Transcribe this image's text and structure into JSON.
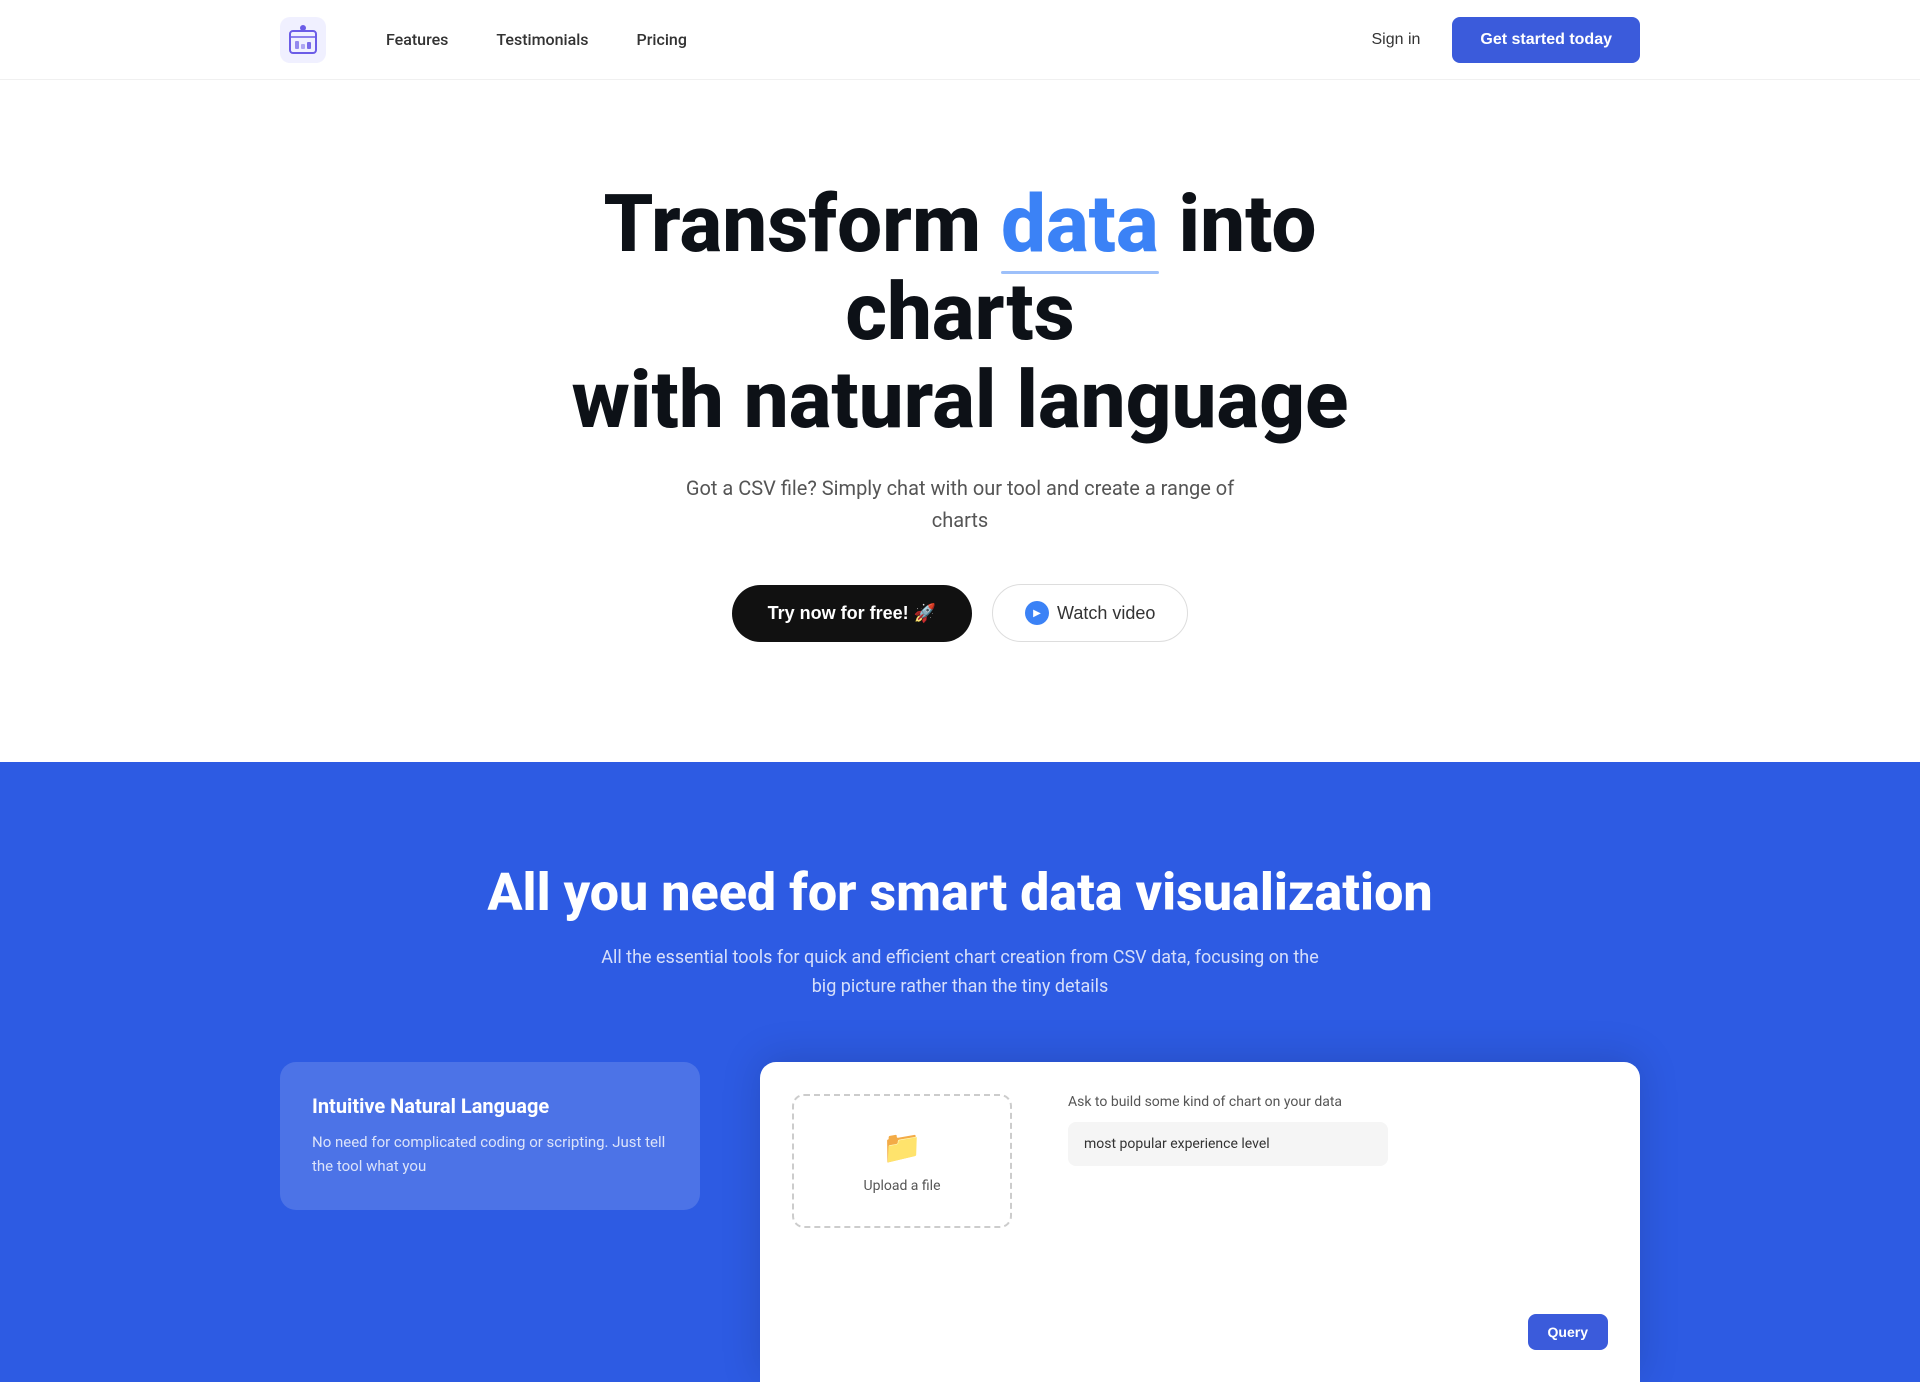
{
  "nav": {
    "logo_alt": "ChartTool Logo",
    "links": [
      {
        "label": "Features",
        "id": "features"
      },
      {
        "label": "Testimonials",
        "id": "testimonials"
      },
      {
        "label": "Pricing",
        "id": "pricing"
      }
    ],
    "sign_in_label": "Sign in",
    "get_started_label": "Get started today"
  },
  "hero": {
    "title_part1": "Transform ",
    "title_highlight": "data",
    "title_part2": " into charts",
    "title_line2": "with natural language",
    "subtitle": "Got a CSV file? Simply chat with our tool and create a range of charts",
    "try_free_label": "Try now for free! 🚀",
    "watch_video_label": "Watch video"
  },
  "features": {
    "title": "All you need for smart data visualization",
    "subtitle": "All the essential tools for quick and efficient chart creation from CSV data, focusing on the big picture rather than the tiny details",
    "feature_card": {
      "title": "Intuitive Natural Language",
      "description": "No need for complicated coding or scripting. Just tell the tool what you"
    },
    "app_preview": {
      "upload_label": "Upload a file",
      "chat_prompt": "Ask to build some kind of chart on your data",
      "chat_placeholder": "most popular experience level",
      "query_button": "Query"
    }
  },
  "colors": {
    "brand_blue": "#3b5bdb",
    "hero_bg": "#ffffff",
    "features_bg": "#2d5be3",
    "title_highlight": "#3b82f6",
    "dark_text": "#0d1117",
    "medium_text": "#555555"
  }
}
